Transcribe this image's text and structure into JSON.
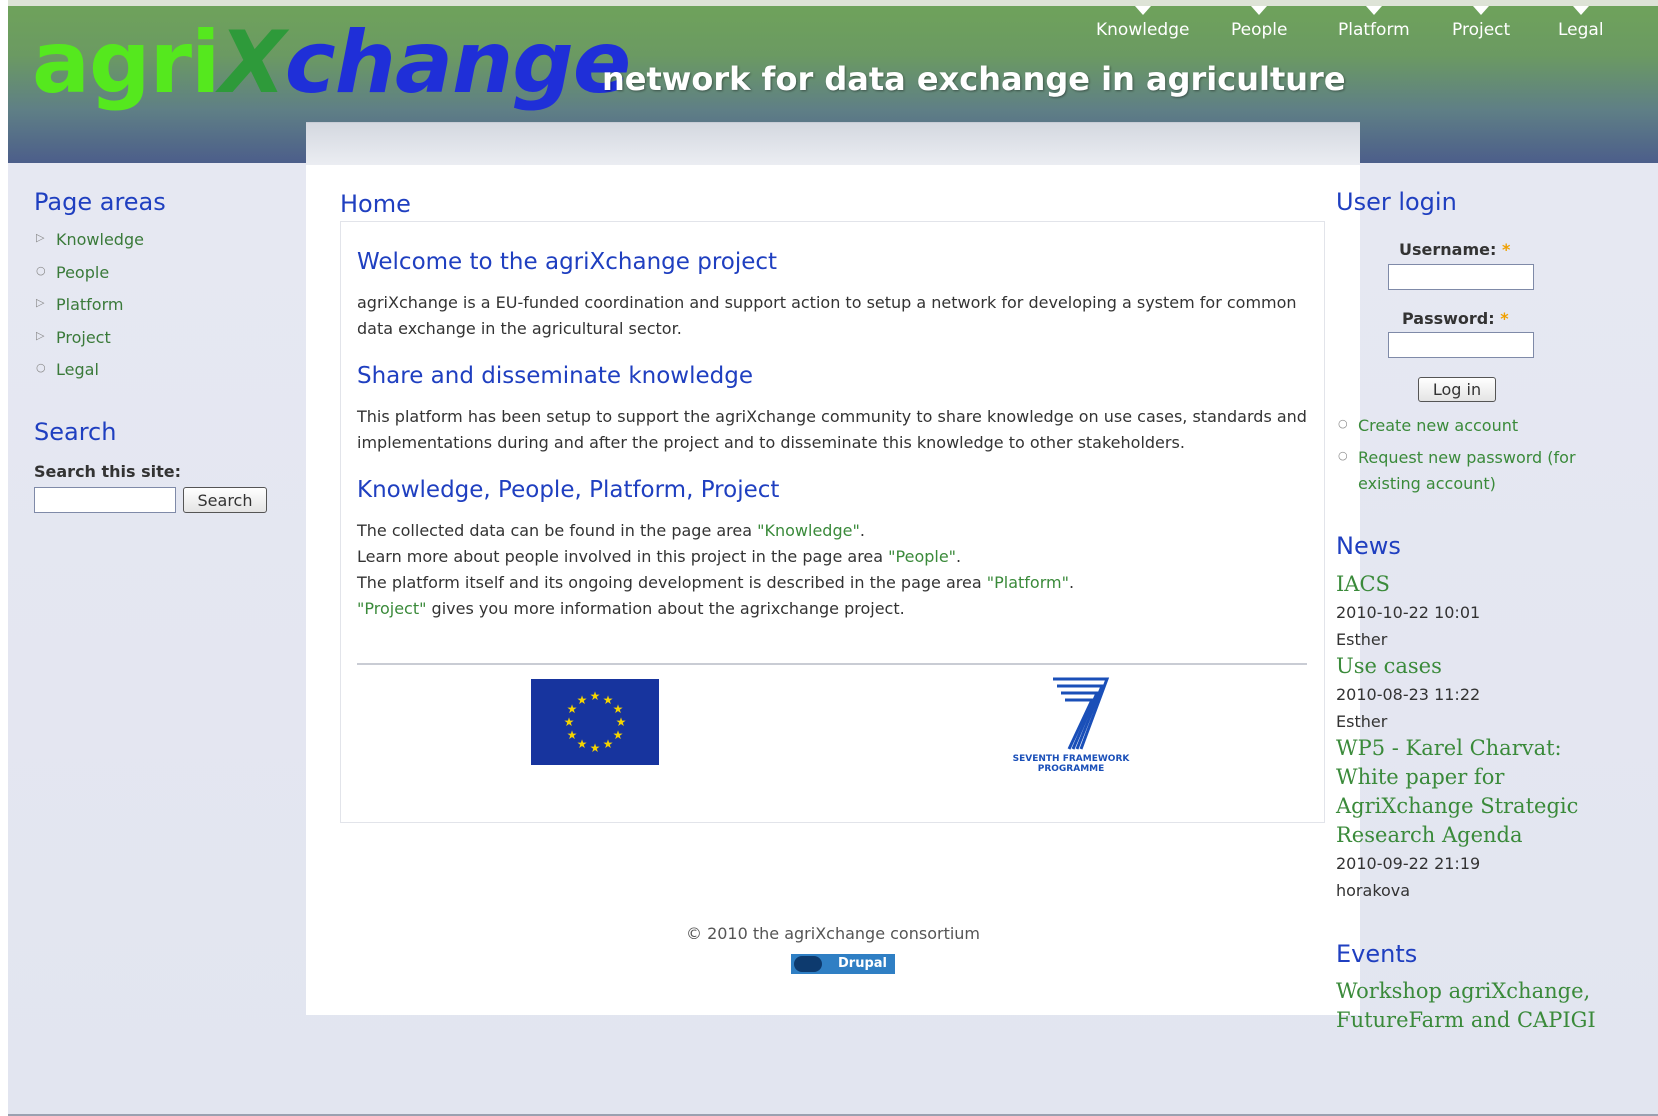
{
  "site": {
    "logo": {
      "agri": "agri",
      "x": "X",
      "change": "change"
    },
    "tagline": "network for data exchange in agriculture"
  },
  "topnav": [
    "Knowledge",
    "People",
    "Platform",
    "Project",
    "Legal"
  ],
  "left_sidebar": {
    "page_areas_title": "Page areas",
    "page_areas": [
      "Knowledge",
      "People",
      "Platform",
      "Project",
      "Legal"
    ],
    "search_title": "Search",
    "search_label": "Search this site:",
    "search_value": "",
    "search_button": "Search"
  },
  "main": {
    "page_title": "Home",
    "sections": [
      {
        "heading": "Welcome to the agriXchange project",
        "body": "agriXchange is a EU-funded coordination and support action to setup a network for developing a system for common data exchange in the agricultural sector."
      },
      {
        "heading": "Share and disseminate knowledge",
        "body": "This platform has been setup to support the agriXchange community to share knowledge on use cases, standards and implementations during and after the project and to disseminate this knowledge to other stakeholders."
      },
      {
        "heading": "Knowledge, People, Platform, Project",
        "lines": [
          {
            "before": "The collected data can be found in the page area ",
            "link": "\"Knowledge\"",
            "after": "."
          },
          {
            "before": "Learn more about people involved in this project in the page area ",
            "link": "\"People\"",
            "after": "."
          },
          {
            "before": "The platform itself and its ongoing development is described in the page area ",
            "link": "\"Platform\"",
            "after": "."
          },
          {
            "before": "",
            "link": "\"Project\"",
            "after": " gives you more information about the agrixchange project."
          }
        ]
      }
    ],
    "fp7_logo": {
      "line1": "SEVENTH FRAMEWORK",
      "line2": "PROGRAMME"
    },
    "footer": "© 2010 the agriXchange consortium",
    "drupal_badge": "Drupal"
  },
  "right_sidebar": {
    "login_title": "User login",
    "username_label": "Username:",
    "password_label": "Password:",
    "required_mark": "*",
    "username_value": "",
    "password_value": "",
    "login_button": "Log in",
    "links": [
      "Create new account",
      "Request new password (for existing account)"
    ],
    "news_title": "News",
    "news": [
      {
        "title": "IACS",
        "date": "2010-10-22 10:01",
        "author": "Esther"
      },
      {
        "title": "Use cases",
        "date": "2010-08-23 11:22",
        "author": "Esther"
      },
      {
        "title": "WP5 - Karel Charvat: White paper for AgriXchange Strategic Research Agenda",
        "date": "2010-09-22 21:19",
        "author": "horakova"
      }
    ],
    "events_title": "Events",
    "events": [
      {
        "title": "Workshop agriXchange, FutureFarm and CAPIGI"
      }
    ]
  },
  "colors": {
    "link": "#3a8a3a",
    "heading": "#1f3fc0",
    "header_green": "#6fa35a",
    "header_blue": "#4c5e8a",
    "eu_blue": "#17349e"
  }
}
